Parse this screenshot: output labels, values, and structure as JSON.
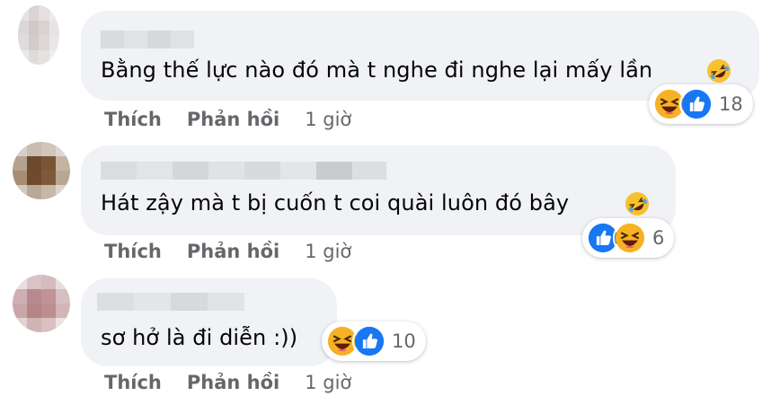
{
  "comments": [
    {
      "text": "Bằng thế lực nào đó mà t nghe đi nghe lại mấy lần",
      "inline_emoji": "rolling-on-floor-laughing",
      "actions": {
        "like": "Thích",
        "reply": "Phản hồi",
        "time": "1 giờ"
      },
      "reactions": {
        "icons": [
          "haha",
          "like"
        ],
        "count": "18"
      }
    },
    {
      "text": "Hát zậy mà t bị cuốn t coi quài luôn đó bây",
      "inline_emoji": "rolling-on-floor-laughing",
      "actions": {
        "like": "Thích",
        "reply": "Phản hồi",
        "time": "1 giờ"
      },
      "reactions": {
        "icons": [
          "like",
          "haha"
        ],
        "count": "6"
      }
    },
    {
      "text": "sơ hở là đi diễn :))",
      "actions": {
        "like": "Thích",
        "reply": "Phản hồi",
        "time": "1 giờ"
      },
      "reactions": {
        "icons": [
          "haha",
          "like"
        ],
        "count": "10"
      }
    }
  ],
  "colors": {
    "bubble": "#f0f2f5",
    "meta_text": "#65676b",
    "like_blue": "#1877f2",
    "haha_yellow": "#f7b125"
  }
}
